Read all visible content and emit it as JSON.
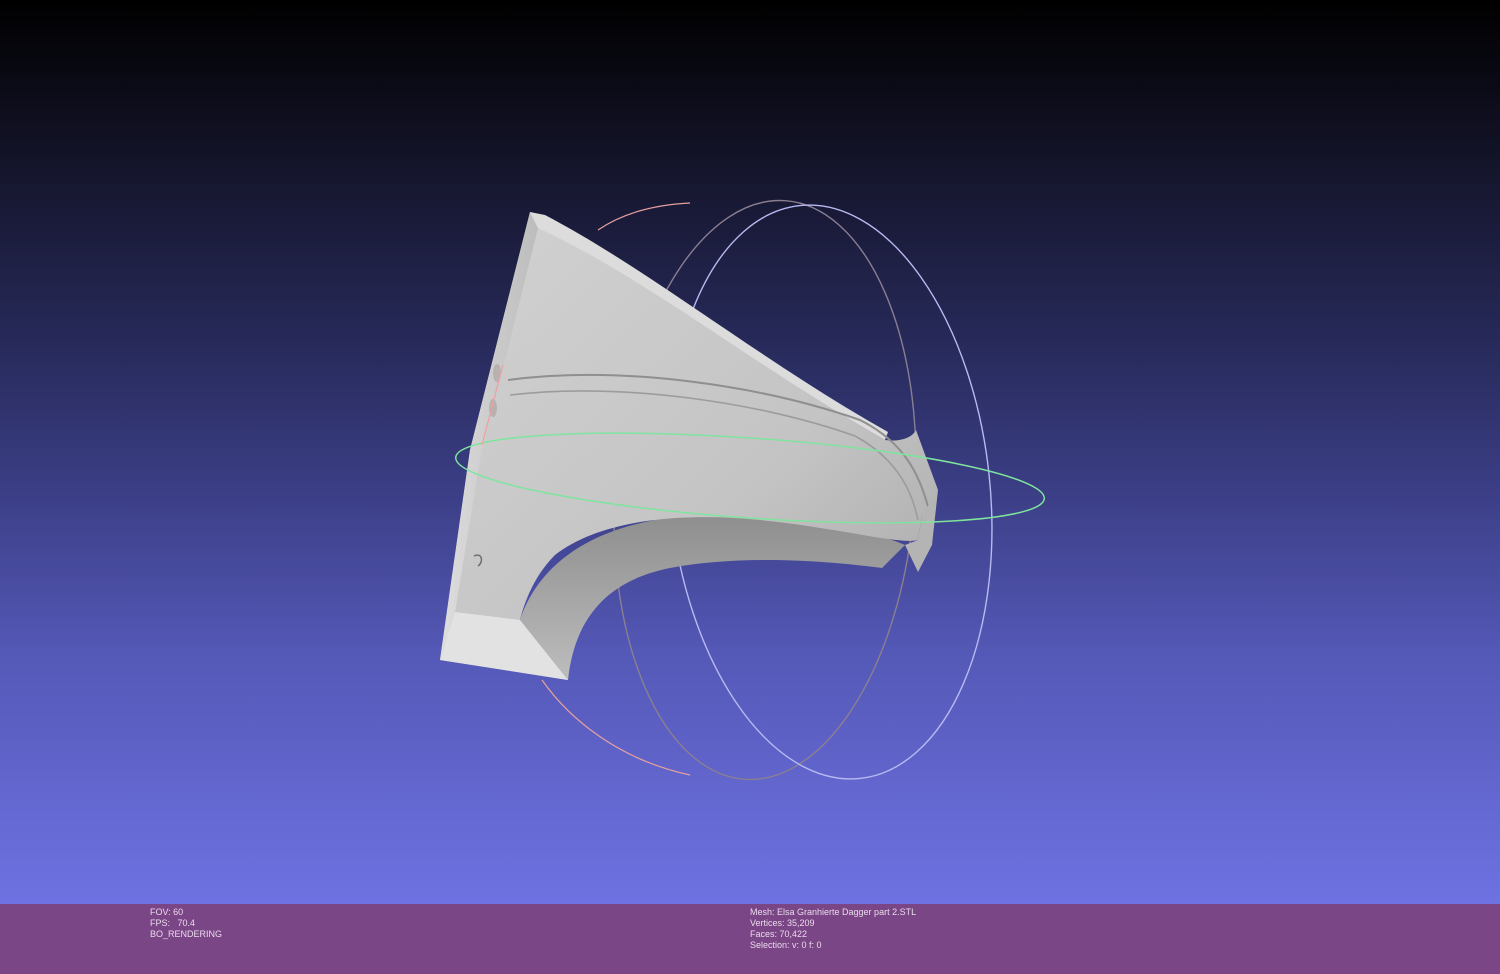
{
  "viewer": {
    "background_top": "#000000",
    "background_bottom": "#6e72e2",
    "info_bar_color": "#7b4686",
    "trackball_colors": {
      "horizontal": "#7be09a",
      "vertical_front": "#b8b8f4",
      "vertical_side": "#9a8c9c",
      "accent": "#e89a9a"
    },
    "mesh_color": "#c8c8c8"
  },
  "info": {
    "left": {
      "fov": "FOV: 60",
      "fps": "FPS:   70.4",
      "mode": "BO_RENDERING"
    },
    "right": {
      "mesh": "Mesh: Elsa Granhierte Dagger part 2.STL",
      "vertices": "Vertices: 35,209",
      "faces": "Faces: 70,422",
      "selection": "Selection: v: 0 f: 0"
    }
  }
}
